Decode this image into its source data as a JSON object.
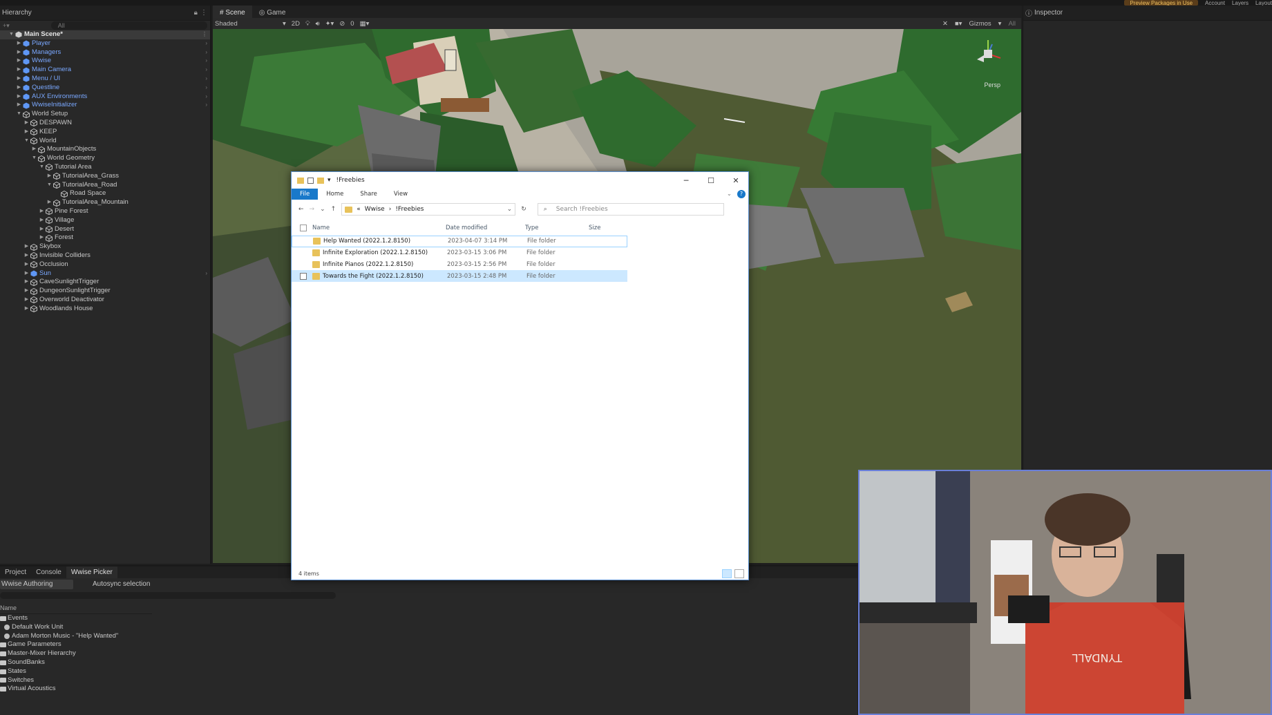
{
  "toolbar": {
    "preview_packages": "Preview Packages in Use",
    "account": "Account",
    "layers": "Layers",
    "layout": "Layout"
  },
  "hierarchy": {
    "tab_label": "Hierarchy",
    "search_placeholder": "All",
    "scene_name": "Main Scene*",
    "items": [
      {
        "label": "Player",
        "prefab": true,
        "depth": 1,
        "arrow": "▶",
        "chev": true
      },
      {
        "label": "Managers",
        "prefab": true,
        "depth": 1,
        "arrow": "▶",
        "chev": true
      },
      {
        "label": "Wwise",
        "prefab": true,
        "depth": 1,
        "arrow": "▶",
        "chev": true
      },
      {
        "label": "Main Camera",
        "prefab": true,
        "depth": 1,
        "arrow": "▶",
        "chev": true
      },
      {
        "label": "Menu / UI",
        "prefab": true,
        "depth": 1,
        "arrow": "▶",
        "chev": true
      },
      {
        "label": "Questline",
        "prefab": true,
        "depth": 1,
        "arrow": "▶",
        "chev": true
      },
      {
        "label": "AUX Environments",
        "prefab": true,
        "depth": 1,
        "arrow": "▶",
        "chev": true
      },
      {
        "label": "WwiseInitializer",
        "prefab": true,
        "depth": 1,
        "arrow": "▶",
        "chev": true
      },
      {
        "label": "World Setup",
        "prefab": false,
        "depth": 1,
        "arrow": "▼",
        "chev": false
      },
      {
        "label": "DESPAWN",
        "prefab": false,
        "depth": 2,
        "arrow": "▶",
        "chev": false
      },
      {
        "label": "KEEP",
        "prefab": false,
        "depth": 2,
        "arrow": "▶",
        "chev": false
      },
      {
        "label": "World",
        "prefab": false,
        "depth": 2,
        "arrow": "▼",
        "chev": false
      },
      {
        "label": "MountainObjects",
        "prefab": false,
        "depth": 3,
        "arrow": "▶",
        "chev": false
      },
      {
        "label": "World Geometry",
        "prefab": false,
        "depth": 3,
        "arrow": "▼",
        "chev": false
      },
      {
        "label": "Tutorial Area",
        "prefab": false,
        "depth": 4,
        "arrow": "▼",
        "chev": false
      },
      {
        "label": "TutorialArea_Grass",
        "prefab": false,
        "depth": 5,
        "arrow": "▶",
        "chev": false
      },
      {
        "label": "TutorialArea_Road",
        "prefab": false,
        "depth": 5,
        "arrow": "▼",
        "chev": false
      },
      {
        "label": "Road Space",
        "prefab": false,
        "depth": 6,
        "arrow": "",
        "chev": false
      },
      {
        "label": "TutorialArea_Mountain",
        "prefab": false,
        "depth": 5,
        "arrow": "▶",
        "chev": false
      },
      {
        "label": "Pine Forest",
        "prefab": false,
        "depth": 4,
        "arrow": "▶",
        "chev": false
      },
      {
        "label": "Village",
        "prefab": false,
        "depth": 4,
        "arrow": "▶",
        "chev": false
      },
      {
        "label": "Desert",
        "prefab": false,
        "depth": 4,
        "arrow": "▶",
        "chev": false
      },
      {
        "label": "Forest",
        "prefab": false,
        "depth": 4,
        "arrow": "▶",
        "chev": false
      },
      {
        "label": "Skybox",
        "prefab": false,
        "depth": 2,
        "arrow": "▶",
        "chev": false
      },
      {
        "label": "Invisible Colliders",
        "prefab": false,
        "depth": 2,
        "arrow": "▶",
        "chev": false
      },
      {
        "label": "Occlusion",
        "prefab": false,
        "depth": 2,
        "arrow": "▶",
        "chev": false
      },
      {
        "label": "Sun",
        "prefab": true,
        "depth": 2,
        "arrow": "▶",
        "chev": true
      },
      {
        "label": "CaveSunlightTrigger",
        "prefab": false,
        "depth": 2,
        "arrow": "▶",
        "chev": false
      },
      {
        "label": "DungeonSunlightTrigger",
        "prefab": false,
        "depth": 2,
        "arrow": "▶",
        "chev": false
      },
      {
        "label": "Overworld Deactivator",
        "prefab": false,
        "depth": 2,
        "arrow": "▶",
        "chev": false
      },
      {
        "label": "Woodlands House",
        "prefab": false,
        "depth": 2,
        "arrow": "▶",
        "chev": false
      }
    ]
  },
  "scene": {
    "tab_scene": "Scene",
    "tab_game": "Game",
    "shading": "Shaded",
    "mode_2d": "2D",
    "hidden_count": "0",
    "gizmos": "Gizmos",
    "search": "All",
    "persp": "Persp"
  },
  "inspector": {
    "tab_label": "Inspector"
  },
  "bottom": {
    "tabs": [
      "Project",
      "Console",
      "Wwise Picker"
    ],
    "dropdown": "Wwise Authoring",
    "autosync": "Autosync selection",
    "col_name": "Name",
    "items": [
      {
        "label": "Events",
        "kind": "folder",
        "indent": 0
      },
      {
        "label": "Default Work Unit",
        "kind": "unit",
        "indent": 1
      },
      {
        "label": "Adam Morton Music - \"Help Wanted\"",
        "kind": "unit",
        "indent": 1
      },
      {
        "label": "Game Parameters",
        "kind": "folder",
        "indent": 0
      },
      {
        "label": "Master-Mixer Hierarchy",
        "kind": "folder",
        "indent": 0
      },
      {
        "label": "SoundBanks",
        "kind": "folder",
        "indent": 0
      },
      {
        "label": "States",
        "kind": "folder",
        "indent": 0
      },
      {
        "label": "Switches",
        "kind": "folder",
        "indent": 0
      },
      {
        "label": "Virtual Acoustics",
        "kind": "folder",
        "indent": 0
      }
    ]
  },
  "explorer": {
    "title": "!Freebies",
    "ribbon": {
      "file": "File",
      "home": "Home",
      "share": "Share",
      "view": "View"
    },
    "breadcrumb": {
      "prefix": "«",
      "parent": "Wwise",
      "sep": "›",
      "current": "!Freebies"
    },
    "search_placeholder": "Search !Freebies",
    "columns": {
      "name": "Name",
      "date": "Date modified",
      "type": "Type",
      "size": "Size"
    },
    "rows": [
      {
        "name": "Help Wanted (2022.1.2.8150)",
        "date": "2023-04-07 3:14 PM",
        "type": "File folder",
        "state": "sel"
      },
      {
        "name": "Infinite Exploration (2022.1.2.8150)",
        "date": "2023-03-15 3:06 PM",
        "type": "File folder",
        "state": ""
      },
      {
        "name": "Infinite Pianos (2022.1.2.8150)",
        "date": "2023-03-15 2:56 PM",
        "type": "File folder",
        "state": ""
      },
      {
        "name": "Towards the Fight (2022.1.2.8150)",
        "date": "2023-03-15 2:48 PM",
        "type": "File folder",
        "state": "hl"
      }
    ],
    "status": "4 items"
  },
  "webcam": {
    "shirt_text": "TYNDALL"
  },
  "colors": {
    "prefab_blue": "#7aa8ff",
    "explorer_accent": "#1979ca",
    "webcam_border": "#6a7fd8"
  }
}
